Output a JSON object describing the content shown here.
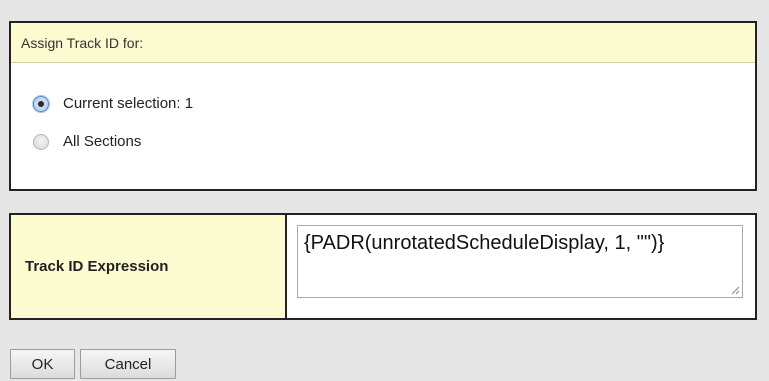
{
  "assign_section": {
    "header": "Assign Track ID for:",
    "options": [
      {
        "label": "Current selection: 1",
        "selected": true
      },
      {
        "label": "All Sections",
        "selected": false
      }
    ]
  },
  "expression_section": {
    "label": "Track ID Expression",
    "value": "{PADR(unrotatedScheduleDisplay, 1, \"\")}"
  },
  "buttons": {
    "ok": "OK",
    "cancel": "Cancel"
  },
  "colors": {
    "header_bg": "#fdfbd0",
    "page_bg": "#e6e6e6",
    "radio_selected_border": "#5b8fd6"
  }
}
